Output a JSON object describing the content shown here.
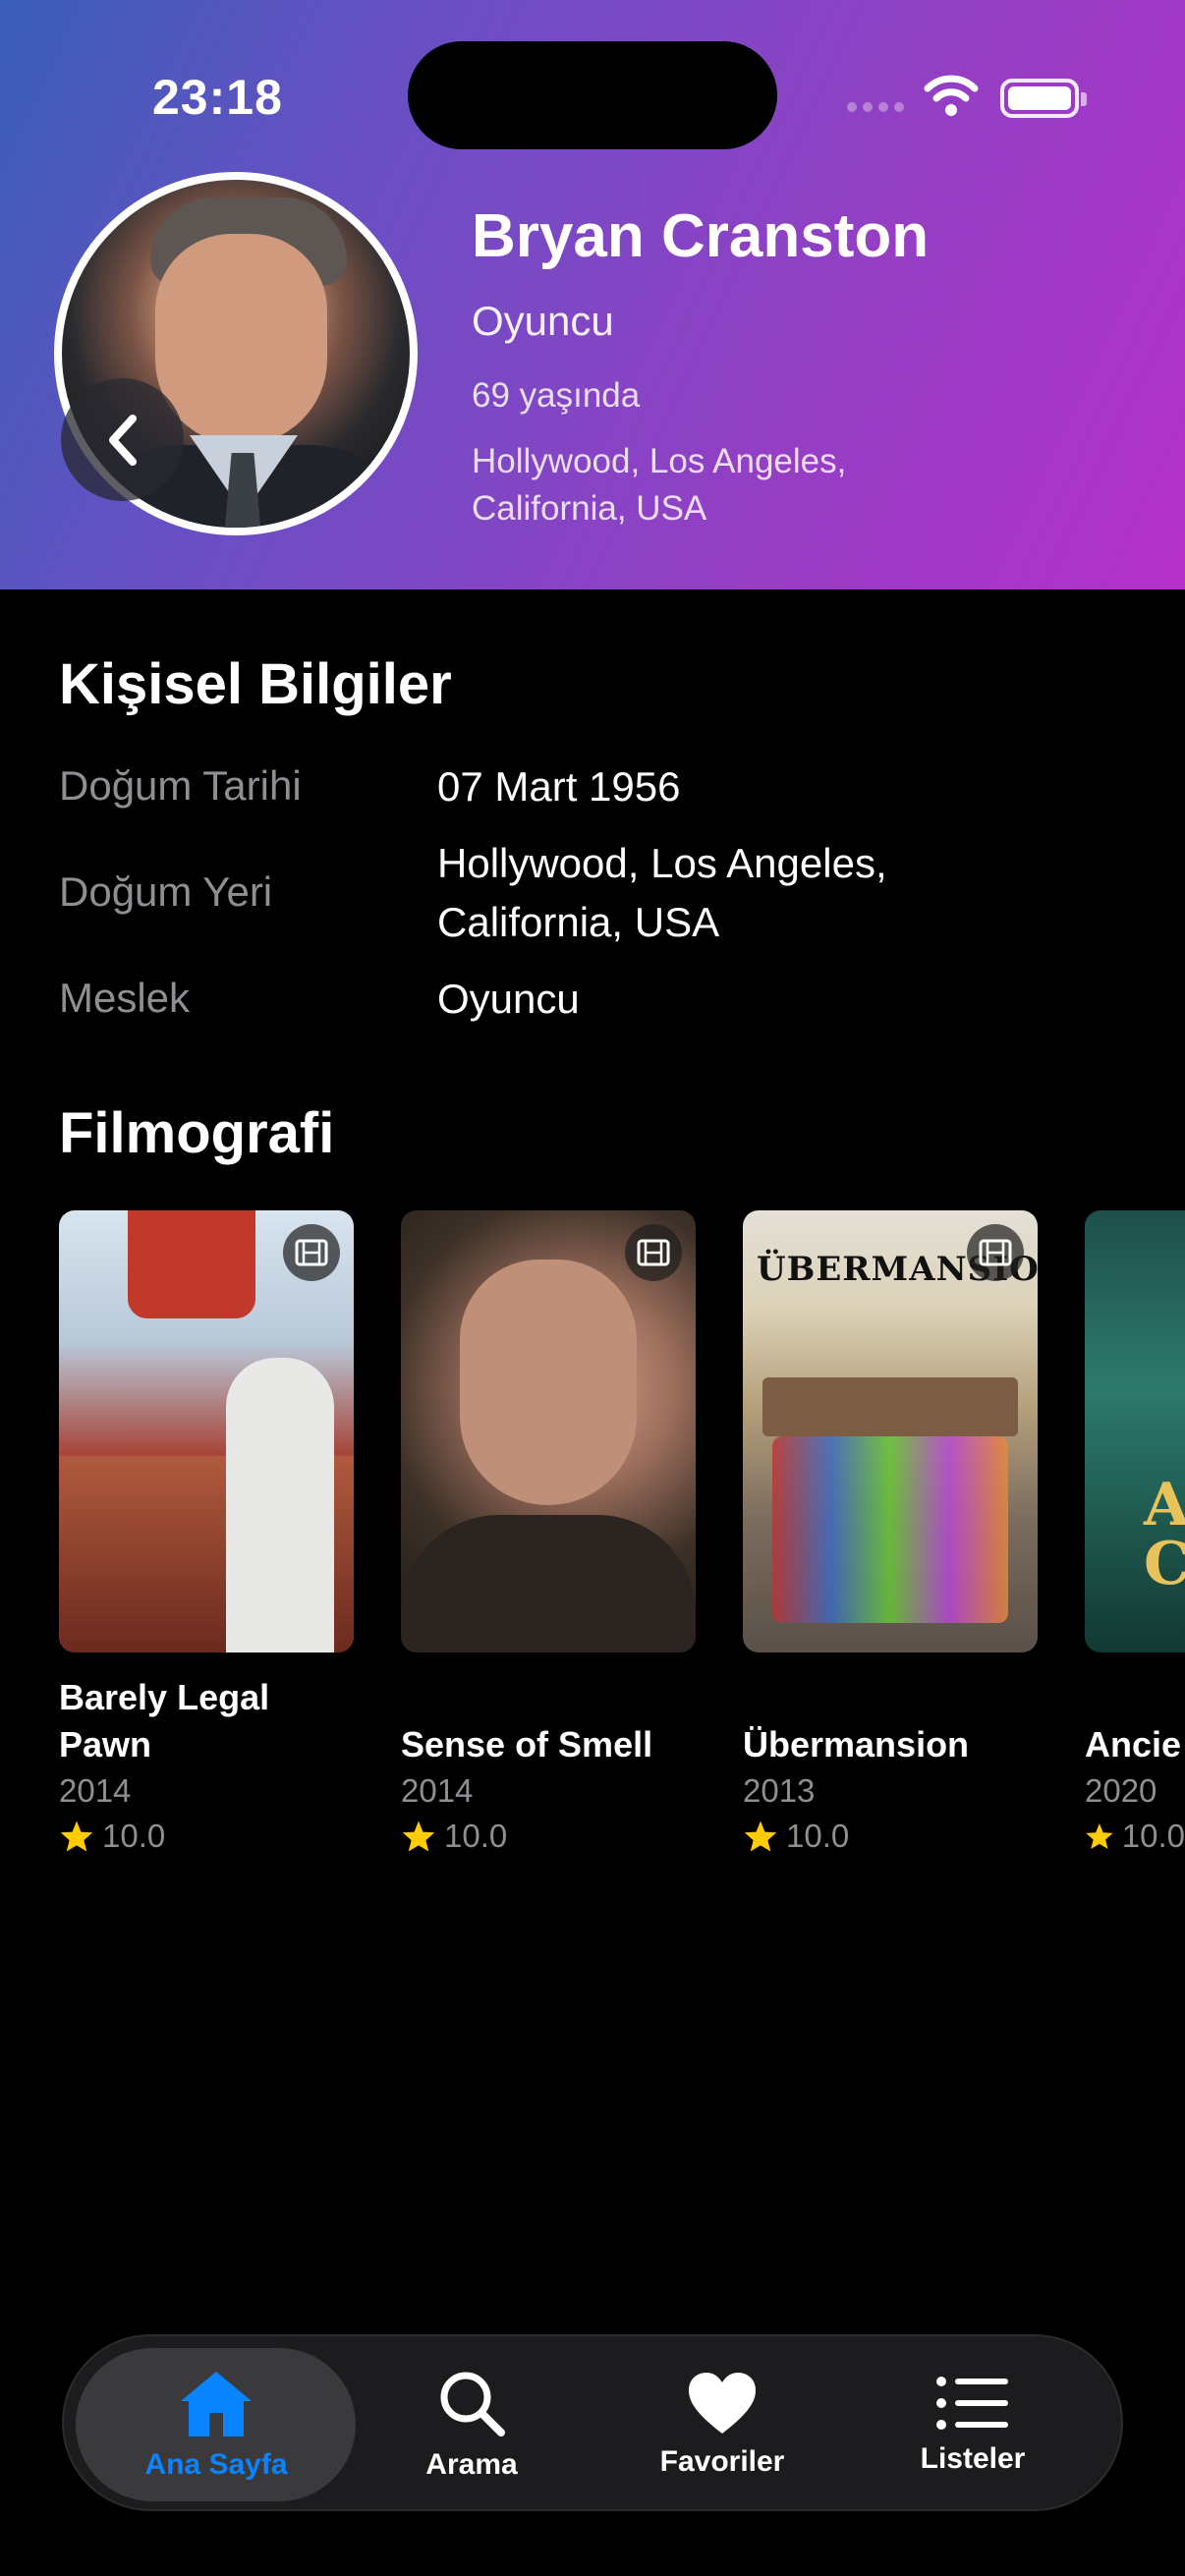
{
  "status_bar": {
    "time": "23:18"
  },
  "profile": {
    "name": "Bryan Cranston",
    "profession": "Oyuncu",
    "age": "69 yaşında",
    "place": "Hollywood, Los Angeles, California, USA"
  },
  "personal_info": {
    "title": "Kişisel Bilgiler",
    "rows": [
      {
        "label": "Doğum Tarihi",
        "value": "07 Mart 1956"
      },
      {
        "label": "Doğum Yeri",
        "value": "Hollywood, Los Angeles, California, USA"
      },
      {
        "label": "Meslek",
        "value": "Oyuncu"
      }
    ]
  },
  "filmography": {
    "title": "Filmografi",
    "items": [
      {
        "title": "Barely Legal Pawn",
        "year": "2014",
        "rating": "10.0"
      },
      {
        "title": "Sense of Smell",
        "year": "2014",
        "rating": "10.0"
      },
      {
        "title": "Übermansion",
        "year": "2013",
        "rating": "10.0",
        "poster_text": "ÜBERMANSION"
      },
      {
        "title": "Ancie",
        "year": "2020",
        "rating": "10.0"
      }
    ]
  },
  "tabbar": {
    "items": [
      {
        "label": "Ana Sayfa",
        "icon": "house-icon",
        "active": true
      },
      {
        "label": "Arama",
        "icon": "search-icon"
      },
      {
        "label": "Favoriler",
        "icon": "heart-icon"
      },
      {
        "label": "Listeler",
        "icon": "list-icon"
      }
    ]
  },
  "colors": {
    "accent": "#0a84ff",
    "star": "#ffcc00",
    "secondary_text": "#8e8e93"
  }
}
